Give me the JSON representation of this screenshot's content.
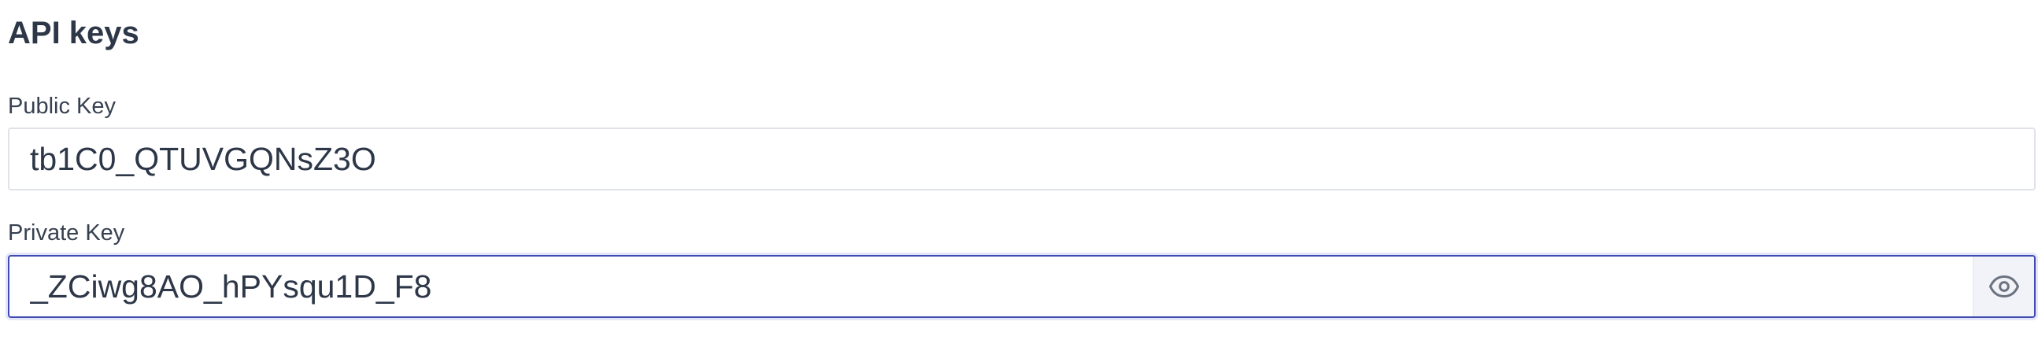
{
  "section": {
    "title": "API keys"
  },
  "public_key": {
    "label": "Public Key",
    "value": "tb1C0_QTUVGQNsZ3O"
  },
  "private_key": {
    "label": "Private Key",
    "value": "_ZCiwg8AO_hPYsqu1D_F8",
    "toggle_icon": "eye-icon"
  },
  "colors": {
    "text": "#2d3748",
    "focus_border": "#3f4bb0",
    "toggle_bg": "#f1f3f8",
    "icon": "#6b7280"
  }
}
